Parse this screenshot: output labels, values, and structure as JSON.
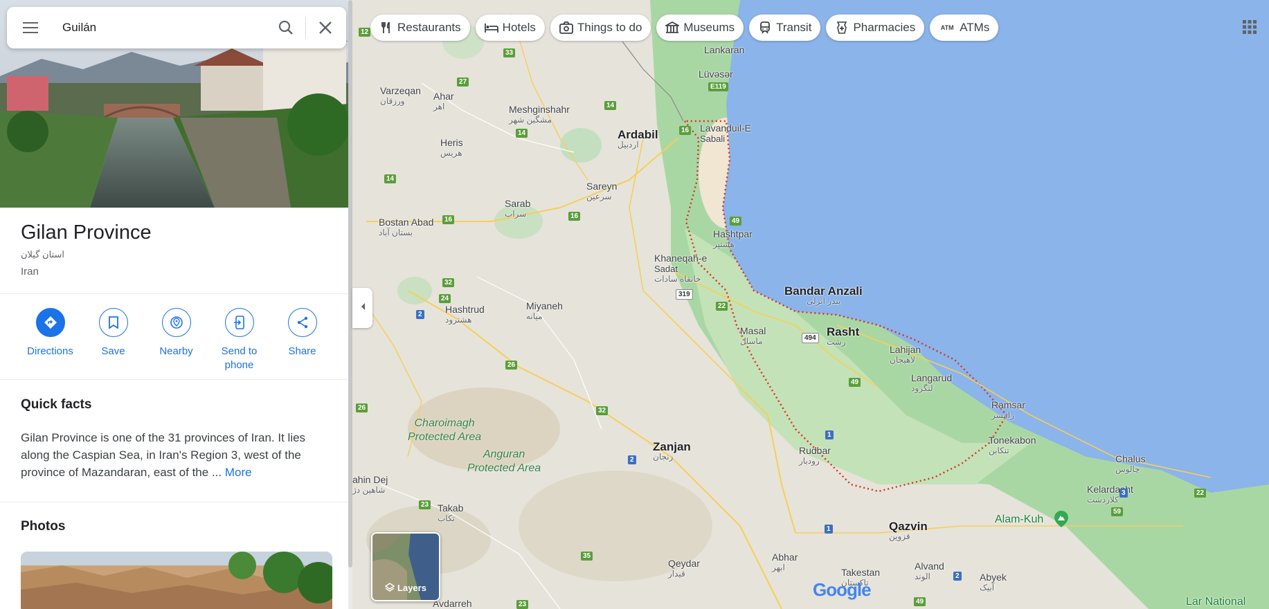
{
  "search": {
    "query": "Guilán"
  },
  "place": {
    "name": "Gilan Province",
    "native_name": "استان گیلان",
    "country": "Iran"
  },
  "actions": [
    {
      "label": "Directions",
      "icon": "directions-icon"
    },
    {
      "label": "Save",
      "icon": "bookmark-icon"
    },
    {
      "label": "Nearby",
      "icon": "nearby-icon"
    },
    {
      "label": "Send to phone",
      "icon": "send-to-phone-icon"
    },
    {
      "label": "Share",
      "icon": "share-icon"
    }
  ],
  "quick_facts": {
    "heading": "Quick facts",
    "text": "Gilan Province is one of the 31 provinces of Iran. It lies along the Caspian Sea, in Iran's Region 3, west of the province of Mazandaran, east of the ... ",
    "more": "More"
  },
  "photos": {
    "heading": "Photos"
  },
  "chips": [
    {
      "label": "Restaurants",
      "icon": "fork-knife-icon"
    },
    {
      "label": "Hotels",
      "icon": "bed-icon"
    },
    {
      "label": "Things to do",
      "icon": "camera-icon"
    },
    {
      "label": "Museums",
      "icon": "museum-icon"
    },
    {
      "label": "Transit",
      "icon": "train-icon"
    },
    {
      "label": "Pharmacies",
      "icon": "pharmacy-icon"
    },
    {
      "label": "ATMs",
      "icon": "atm-icon"
    }
  ],
  "map": {
    "layers_label": "Layers",
    "google": "Google",
    "places": {
      "lankaran": "Lankaran",
      "luvaser": "Lüvəsər",
      "ardabil": "Ardabil",
      "ardabil_fa": "اردبیل",
      "lavanduil": "Lavanduil-E",
      "sabali": "Sabali",
      "varzeqan": "Varzeqan",
      "varzeqan_fa": "ورزقان",
      "ahar": "Ahar",
      "ahar_fa": "اهر",
      "meshginshahr": "Meshginshahr",
      "meshginshahr_fa": "مشگین شهر",
      "heris": "Heris",
      "heris_fa": "هریس",
      "sareyn": "Sareyn",
      "sareyn_fa": "سرعین",
      "sarab": "Sarab",
      "sarab_fa": "سراب",
      "bostanabad": "Bostan Abad",
      "bostanabad_fa": "بستان آباد",
      "hashtpar": "Hashtpar",
      "hashtpar_fa": "هشتپر",
      "khaneqah": "Khaneqah-e",
      "sadat": "Sadat",
      "khaneqah_fa": "خانقاه سادات",
      "bandaranzali": "Bandar Anzali",
      "bandaranzali_fa": "بندر انزلی",
      "rasht": "Rasht",
      "rasht_fa": "رشت",
      "masal": "Masal",
      "masal_fa": "ماسال",
      "lahijan": "Lahijan",
      "lahijan_fa": "لاهیجان",
      "langarud": "Langarud",
      "langarud_fa": "لنگرود",
      "hashtrud": "Hashtrud",
      "hashtrud_fa": "هشترود",
      "miyaneh": "Miyaneh",
      "miyaneh_fa": "میانه",
      "ramsar": "Ramsar",
      "ramsar_fa": "رامسر",
      "tonekabon": "Tonekabon",
      "tonekabon_fa": "تنکابن",
      "chalus": "Chalus",
      "chalus_fa": "چالوس",
      "kelardasht": "Kelardasht",
      "kelardasht_fa": "کلاردشت",
      "alamkuh": "Alam-Kuh",
      "rudbar": "Rudbar",
      "rudbar_fa": "رودبار",
      "zanjan": "Zanjan",
      "zanjan_fa": "زنجان",
      "qazvin": "Qazvin",
      "qazvin_fa": "قزوین",
      "takab": "Takab",
      "takab_fa": "تکاب",
      "shahindej": "ahin Dej",
      "shahindej_fa": "شاهین دژ",
      "abhar": "Abhar",
      "abhar_fa": "ابهر",
      "takestan": "Takestan",
      "takestan_fa": "تاکستان",
      "alvand": "Alvand",
      "alvand_fa": "الوند",
      "abyek": "Abyek",
      "abyek_fa": "آبیک",
      "qeydar": "Qeydar",
      "qeydar_fa": "قیدار",
      "avdarreh": "Avdarreh",
      "larnational": "Lar National"
    },
    "areas": {
      "charoimagh": "Charoimagh\nProtected Area",
      "anguran": "Anguran\nProtected Area"
    },
    "roads": {
      "r12": "12",
      "r33": "33",
      "r27": "27",
      "r14a": "14",
      "r14b": "14",
      "r14c": "14",
      "r16a": "16",
      "r16b": "16",
      "r16c": "16",
      "e119": "E119",
      "r49a": "49",
      "r49b": "49",
      "r32a": "32",
      "r32b": "32",
      "r24": "24",
      "r2a": "2",
      "r2b": "2",
      "r2c": "2",
      "r22a": "22",
      "r22b": "22",
      "r26a": "26",
      "r26b": "26",
      "r319": "319",
      "r494": "494",
      "r1a": "1",
      "r1b": "1",
      "r23a": "23",
      "r23b": "23",
      "r35": "35",
      "r3": "3",
      "r59": "59",
      "r49c": "49"
    }
  }
}
